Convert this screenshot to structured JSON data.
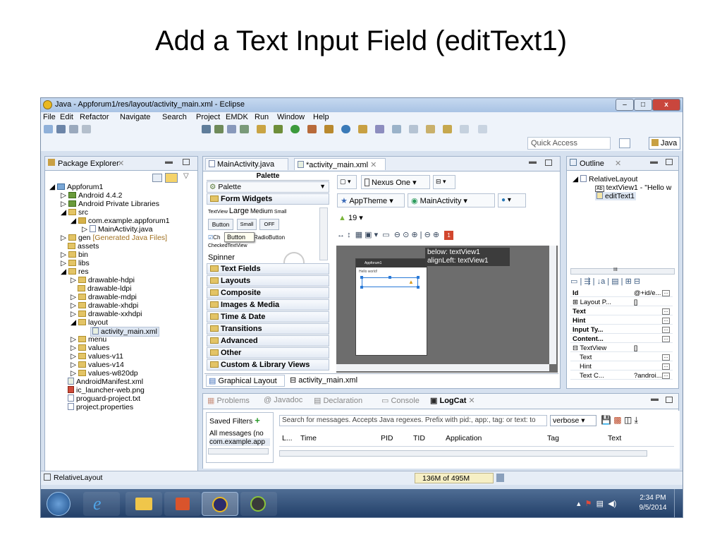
{
  "slide_title": "Add a Text Input Field (editText1)",
  "window": {
    "title": "Java - Appforum1/res/layout/activity_main.xml - Eclipse",
    "min_label": "–",
    "max_label": "□",
    "close_label": "x"
  },
  "menu": [
    "File",
    "Edit",
    "Refactor",
    "Navigate",
    "Search",
    "Project",
    "EMDK",
    "Run",
    "Window",
    "Help"
  ],
  "toolbar": {
    "quick_access_placeholder": "Quick Access",
    "perspective": "Java"
  },
  "package_explorer": {
    "title": "Package Explorer",
    "items": [
      {
        "label": "Appforum1",
        "level": 0
      },
      {
        "label": "Android 4.4.2",
        "level": 1
      },
      {
        "label": "Android Private Libraries",
        "level": 1
      },
      {
        "label": "src",
        "level": 1
      },
      {
        "label": "com.example.appforum1",
        "level": 2
      },
      {
        "label": "MainActivity.java",
        "level": 3
      },
      {
        "label": "gen",
        "level": 1,
        "suffix": "[Generated Java Files]"
      },
      {
        "label": "assets",
        "level": 1
      },
      {
        "label": "bin",
        "level": 1
      },
      {
        "label": "libs",
        "level": 1
      },
      {
        "label": "res",
        "level": 1
      },
      {
        "label": "drawable-hdpi",
        "level": 2
      },
      {
        "label": "drawable-ldpi",
        "level": 2
      },
      {
        "label": "drawable-mdpi",
        "level": 2
      },
      {
        "label": "drawable-xhdpi",
        "level": 2
      },
      {
        "label": "drawable-xxhdpi",
        "level": 2
      },
      {
        "label": "layout",
        "level": 2
      },
      {
        "label": "activity_main.xml",
        "level": 3,
        "selected": true
      },
      {
        "label": "menu",
        "level": 2
      },
      {
        "label": "values",
        "level": 2
      },
      {
        "label": "values-v11",
        "level": 2
      },
      {
        "label": "values-v14",
        "level": 2
      },
      {
        "label": "values-w820dp",
        "level": 2
      },
      {
        "label": "AndroidManifest.xml",
        "level": 1
      },
      {
        "label": "ic_launcher-web.png",
        "level": 1
      },
      {
        "label": "proguard-project.txt",
        "level": 1
      },
      {
        "label": "project.properties",
        "level": 1
      }
    ]
  },
  "editor": {
    "tabs": [
      "MainActivity.java",
      "*activity_main.xml"
    ],
    "palette_title": "Palette",
    "palette_dropdown": "Palette",
    "form_widgets": "Form Widgets",
    "text_sizes": {
      "textview": "TextView",
      "large": "Large",
      "medium": "Medium",
      "small": "Small"
    },
    "widget_buttons": [
      "Button",
      "Small",
      "OFF"
    ],
    "tooltip_button": "Button",
    "check_label": "Ch",
    "radio_label": "RadioButton",
    "checked_textview": "CheckedTextView",
    "spinner": "Spinner",
    "categories": [
      "Text Fields",
      "Layouts",
      "Composite",
      "Images & Media",
      "Time & Date",
      "Transitions",
      "Advanced",
      "Other",
      "Custom & Library Views"
    ],
    "device": "Nexus One",
    "theme": "AppTheme",
    "activity": "MainActivity",
    "api": "19",
    "canvas_tooltip_1": "below: textView1",
    "canvas_tooltip_2": "alignLeft: textView1",
    "app_name": "Appforum1",
    "hello_text": "Hello world!",
    "warning_count": "1",
    "bottom_tabs": [
      "Graphical Layout",
      "activity_main.xml"
    ]
  },
  "outline": {
    "title": "Outline",
    "root": "RelativeLayout",
    "child1": "textView1 - \"Hello w",
    "child2": "editText1",
    "properties": [
      {
        "name": "Id",
        "value": "@+id/e...",
        "bold": true
      },
      {
        "name": "⊞ Layout P...",
        "value": "[]",
        "bold": false
      },
      {
        "name": "Text",
        "value": "",
        "bold": true
      },
      {
        "name": "Hint",
        "value": "",
        "bold": true
      },
      {
        "name": "Input Ty...",
        "value": "",
        "bold": true
      },
      {
        "name": "Content...",
        "value": "",
        "bold": true
      },
      {
        "name": "⊟ TextView",
        "value": "[]",
        "bold": false
      },
      {
        "name": "Text",
        "value": "",
        "bold": false
      },
      {
        "name": "Hint",
        "value": "",
        "bold": false
      },
      {
        "name": "Text C...",
        "value": "?androi...",
        "bold": false
      }
    ],
    "scroll_label": "III"
  },
  "bottom_panel": {
    "tabs": [
      "Problems",
      "Javadoc",
      "Declaration",
      "Console",
      "LogCat"
    ],
    "saved_filters": "Saved Filters",
    "filter_items": [
      "All messages (no",
      "com.example.app"
    ],
    "search_placeholder": "Search for messages. Accepts Java regexes. Prefix with pid:, app:, tag: or text: to",
    "level": "verbose",
    "columns": [
      "L...",
      "Time",
      "PID",
      "TID",
      "Application",
      "Tag",
      "Text"
    ]
  },
  "status": {
    "left": "RelativeLayout",
    "memory": "136M of 495M"
  },
  "taskbar": {
    "time": "2:34 PM",
    "date": "9/5/2014"
  }
}
